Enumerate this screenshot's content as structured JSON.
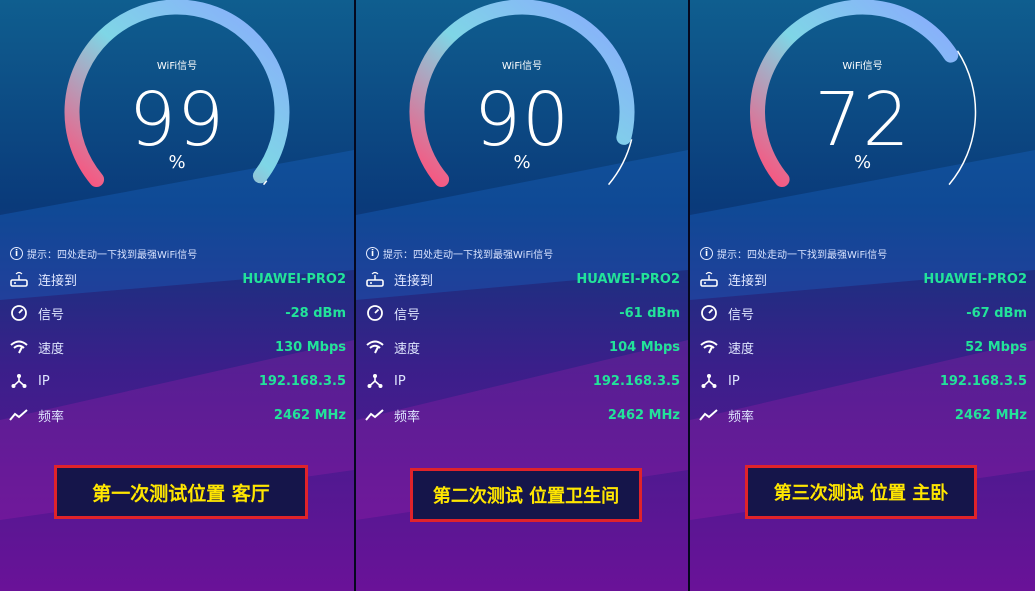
{
  "panels": [
    {
      "wifi_label": "WiFi信号",
      "signal_value": "99",
      "signal_fraction": 0.99,
      "unit": "%",
      "tip": "提示：四处走动一下找到最强WiFi信号",
      "rows": [
        {
          "icon": "router-icon",
          "label": "连接到",
          "value": "HUAWEI-PRO2"
        },
        {
          "icon": "signal-gauge-icon",
          "label": "信号",
          "value": "-28 dBm"
        },
        {
          "icon": "wifi-speed-icon",
          "label": "速度",
          "value": "130 Mbps"
        },
        {
          "icon": "network-ip-icon",
          "label": "IP",
          "value": "192.168.3.5"
        },
        {
          "icon": "frequency-icon",
          "label": "频率",
          "value": "2462 MHz"
        }
      ],
      "caption": "第一次测试位置 客厅"
    },
    {
      "wifi_label": "WiFi信号",
      "signal_value": "90",
      "signal_fraction": 0.9,
      "unit": "%",
      "tip": "提示：四处走动一下找到最强WiFi信号",
      "rows": [
        {
          "icon": "router-icon",
          "label": "连接到",
          "value": "HUAWEI-PRO2"
        },
        {
          "icon": "signal-gauge-icon",
          "label": "信号",
          "value": "-61 dBm"
        },
        {
          "icon": "wifi-speed-icon",
          "label": "速度",
          "value": "104 Mbps"
        },
        {
          "icon": "network-ip-icon",
          "label": "IP",
          "value": "192.168.3.5"
        },
        {
          "icon": "frequency-icon",
          "label": "频率",
          "value": "2462 MHz"
        }
      ],
      "caption": "第二次测试 位置卫生间"
    },
    {
      "wifi_label": "WiFi信号",
      "signal_value": "72",
      "signal_fraction": 0.72,
      "unit": "%",
      "tip": "提示：四处走动一下找到最强WiFi信号",
      "rows": [
        {
          "icon": "router-icon",
          "label": "连接到",
          "value": "HUAWEI-PRO2"
        },
        {
          "icon": "signal-gauge-icon",
          "label": "信号",
          "value": "-67 dBm"
        },
        {
          "icon": "wifi-speed-icon",
          "label": "速度",
          "value": "52 Mbps"
        },
        {
          "icon": "network-ip-icon",
          "label": "IP",
          "value": "192.168.3.5"
        },
        {
          "icon": "frequency-icon",
          "label": "频率",
          "value": "2462 MHz"
        }
      ],
      "caption": "第三次测试 位置 主卧"
    }
  ],
  "colors": {
    "value_green": "#22e39a",
    "caption_text": "#ffe600",
    "caption_border": "#e0232a",
    "gauge_start": "#ff4f7a",
    "gauge_end": "#8aa8ff"
  }
}
